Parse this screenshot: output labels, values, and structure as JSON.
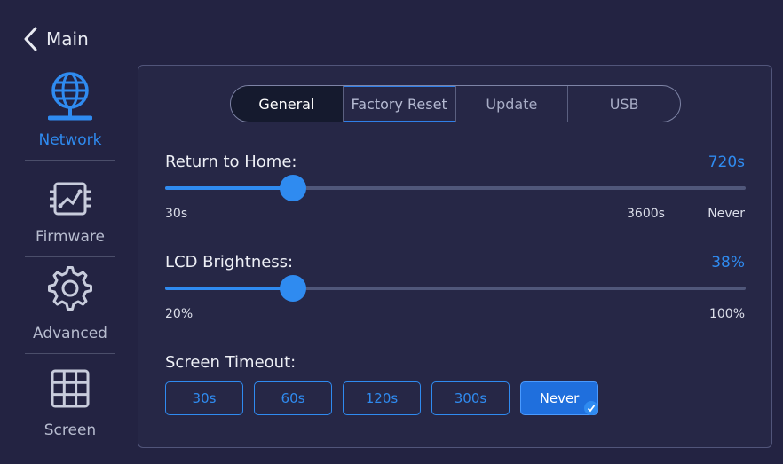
{
  "header": {
    "back_icon": "chevron-left-icon",
    "title": "Main"
  },
  "sidebar": {
    "items": [
      {
        "label": "Network",
        "icon": "globe-network-icon",
        "active": true
      },
      {
        "label": "Firmware",
        "icon": "chip-board-icon",
        "active": false
      },
      {
        "label": "Advanced",
        "icon": "gear-icon",
        "active": false
      },
      {
        "label": "Screen",
        "icon": "grid-icon",
        "active": false
      }
    ]
  },
  "tabs": [
    {
      "label": "General",
      "active": true
    },
    {
      "label": "Factory Reset",
      "active": false
    },
    {
      "label": "Update",
      "active": false
    },
    {
      "label": "USB",
      "active": false
    }
  ],
  "return_home": {
    "label": "Return to Home:",
    "value": "720s",
    "fraction": 0.22,
    "min": "30s",
    "mark": "3600s",
    "max": "Never"
  },
  "brightness": {
    "label": "LCD Brightness:",
    "value": "38%",
    "fraction": 0.22,
    "min": "20%",
    "max": "100%"
  },
  "screen_timeout": {
    "label": "Screen Timeout:",
    "options": [
      "30s",
      "60s",
      "120s",
      "300s",
      "Never"
    ],
    "selected": "Never"
  },
  "colors": {
    "accent": "#2f8bf0",
    "background": "#232342",
    "panel_border": "#51557a"
  }
}
